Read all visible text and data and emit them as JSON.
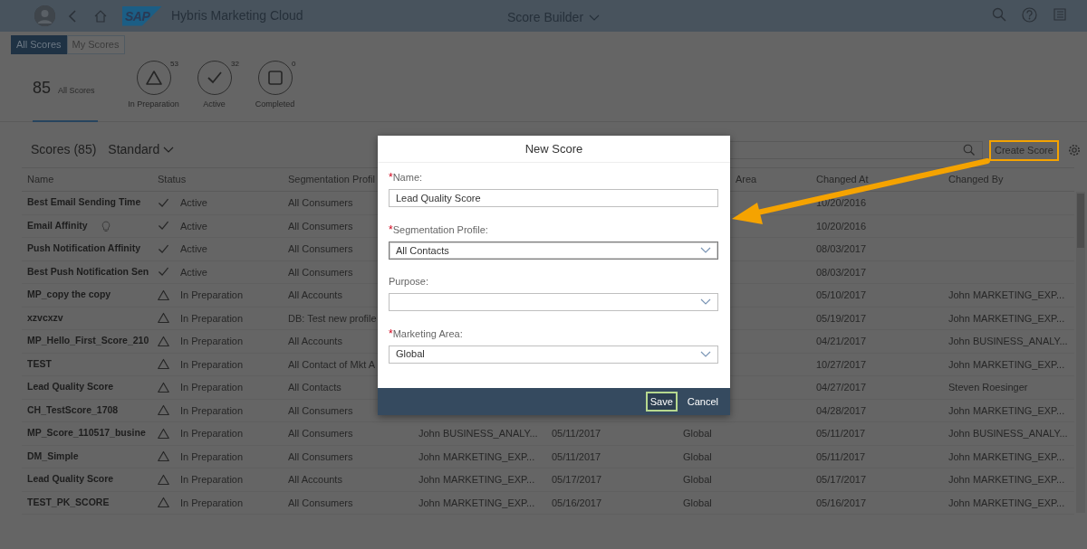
{
  "shell": {
    "logo_text": "SAP",
    "app_title": "Hybris Marketing Cloud",
    "page_title": "Score Builder"
  },
  "view_switch": [
    {
      "label": "All Scores",
      "selected": true
    },
    {
      "label": "My Scores",
      "selected": false
    }
  ],
  "filters": [
    {
      "kind": "total",
      "count": "85",
      "label": "All Scores",
      "selected": true
    },
    {
      "kind": "in_preparation",
      "count": "53",
      "label": "In Preparation",
      "selected": false
    },
    {
      "kind": "active",
      "count": "32",
      "label": "Active",
      "selected": false
    },
    {
      "kind": "completed",
      "count": "0",
      "label": "Completed",
      "selected": false
    }
  ],
  "toolbar": {
    "title": "Scores (85)",
    "variant": "Standard",
    "create_button": "Create Score"
  },
  "table": {
    "columns": {
      "name": "Name",
      "status": "Status",
      "segmentation_profile": "Segmentation Profil",
      "area": "Area",
      "changed_at": "Changed At",
      "changed_by": "Changed By"
    },
    "rows": [
      {
        "name": "Best Email Sending Time",
        "bulb": false,
        "kind": "active",
        "status": "Active",
        "segmentation_profile": "All Consumers",
        "changed_at": "10/20/2016"
      },
      {
        "name": "Email Affinity",
        "bulb": true,
        "kind": "active",
        "status": "Active",
        "segmentation_profile": "All Consumers",
        "changed_at": "10/20/2016"
      },
      {
        "name": "Push Notification Affinity",
        "bulb": false,
        "kind": "active",
        "status": "Active",
        "segmentation_profile": "All Consumers",
        "changed_at": "08/03/2017"
      },
      {
        "name": "Best Push Notification Sen",
        "bulb": false,
        "kind": "active",
        "status": "Active",
        "segmentation_profile": "All Consumers",
        "changed_at": "08/03/2017"
      },
      {
        "name": "MP_copy the copy",
        "bulb": false,
        "kind": "in_preparation",
        "status": "In Preparation",
        "segmentation_profile": "All Accounts",
        "changed_at": "05/10/2017",
        "changed_by": "John MARKETING_EXP..."
      },
      {
        "name": "xzvcxzv",
        "bulb": false,
        "kind": "in_preparation",
        "status": "In Preparation",
        "segmentation_profile": "DB: Test new profile",
        "changed_at": "05/19/2017",
        "changed_by": "John MARKETING_EXP..."
      },
      {
        "name": "MP_Hello_First_Score_210",
        "bulb": false,
        "kind": "in_preparation",
        "status": "In Preparation",
        "segmentation_profile": "All Accounts",
        "changed_at": "04/21/2017",
        "changed_by": "John BUSINESS_ANALY..."
      },
      {
        "name": "TEST",
        "bulb": false,
        "kind": "in_preparation",
        "status": "In Preparation",
        "segmentation_profile": "All Contact of Mkt A",
        "changed_at": "10/27/2017",
        "changed_by": "John MARKETING_EXP..."
      },
      {
        "name": "Lead Quality Score",
        "bulb": false,
        "kind": "in_preparation",
        "status": "In Preparation",
        "segmentation_profile": "All Contacts",
        "changed_at": "04/27/2017",
        "changed_by": "Steven Roesinger"
      },
      {
        "name": "CH_TestScore_1708",
        "bulb": false,
        "kind": "in_preparation",
        "status": "In Preparation",
        "segmentation_profile": "All Consumers",
        "changed_at": "04/28/2017",
        "changed_by": "John MARKETING_EXP..."
      },
      {
        "name": "MP_Score_110517_busine",
        "bulb": false,
        "kind": "in_preparation",
        "status": "In Preparation",
        "segmentation_profile": "All Consumers",
        "column_4": "John BUSINESS_ANALY...",
        "column_5": "05/11/2017",
        "area": "Global",
        "changed_at": "05/11/2017",
        "changed_by": "John BUSINESS_ANALY..."
      },
      {
        "name": "DM_Simple",
        "bulb": false,
        "kind": "in_preparation",
        "status": "In Preparation",
        "segmentation_profile": "All Consumers",
        "column_4": "John MARKETING_EXP...",
        "column_5": "05/11/2017",
        "area": "Global",
        "changed_at": "05/11/2017",
        "changed_by": "John MARKETING_EXP..."
      },
      {
        "name": "Lead Quality Score",
        "bulb": false,
        "kind": "in_preparation",
        "status": "In Preparation",
        "segmentation_profile": "All Accounts",
        "column_4": "John MARKETING_EXP...",
        "column_5": "05/17/2017",
        "area": "Global",
        "changed_at": "05/17/2017",
        "changed_by": "John MARKETING_EXP..."
      },
      {
        "name": "TEST_PK_SCORE",
        "bulb": false,
        "kind": "in_preparation",
        "status": "In Preparation",
        "segmentation_profile": "All Consumers",
        "column_4": "John MARKETING_EXP...",
        "column_5": "05/16/2017",
        "area": "Global",
        "changed_at": "05/16/2017",
        "changed_by": "John MARKETING_EXP..."
      }
    ]
  },
  "dialog": {
    "title": "New Score",
    "fields": [
      {
        "kind": "input",
        "label": "Name:",
        "required_mark": "*",
        "focused": false,
        "value": "Lead Quality Score"
      },
      {
        "kind": "select",
        "label": "Segmentation Profile:",
        "required_mark": "*",
        "focused": true,
        "value": "All Contacts"
      },
      {
        "kind": "select",
        "label": "Purpose:",
        "focused": false
      },
      {
        "kind": "select",
        "label": "Marketing Area:",
        "required_mark": "*",
        "focused": false,
        "value": "Global"
      }
    ],
    "buttons": [
      {
        "label": "Save",
        "highlighted": true
      },
      {
        "label": "Cancel",
        "highlighted": false
      }
    ]
  }
}
